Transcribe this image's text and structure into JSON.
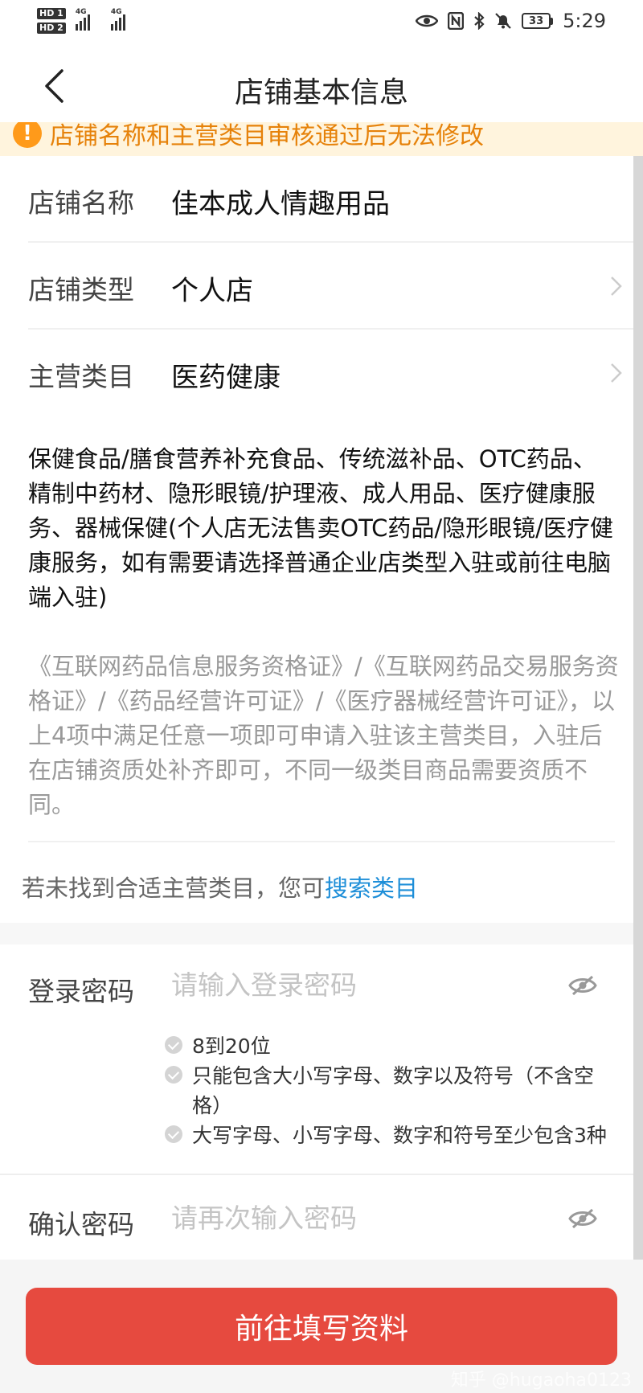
{
  "status_bar": {
    "sim1": "HD 1",
    "sim2": "HD 2",
    "net1": "4G",
    "net2": "4G",
    "battery": "33",
    "time": "5:29"
  },
  "nav": {
    "title": "店铺基本信息",
    "back_icon": "chevron-left-icon"
  },
  "warning": {
    "text": "店铺名称和主营类目审核通过后无法修改",
    "icon": "!"
  },
  "store_info": {
    "name_label": "店铺名称",
    "name_value": "佳本成人情趣用品",
    "type_label": "店铺类型",
    "type_value": "个人店",
    "category_label": "主营类目",
    "category_value": "医药健康",
    "category_desc": "保健食品/膳食营养补充食品、传统滋补品、OTC药品、精制中药材、隐形眼镜/护理液、成人用品、医疗健康服务、器械保健(个人店无法售卖OTC药品/隐形眼镜/医疗健康服务，如有需要请选择普通企业店类型入驻或前往电脑端入驻)",
    "qualification_desc": "《互联网药品信息服务资格证》/《互联网药品交易服务资格证》/《药品经营许可证》/《医疗器械经营许可证》，以上4项中满足任意一项即可申请入驻该主营类目，入驻后在店铺资质处补齐即可，不同一级类目商品需要资质不同。",
    "search_hint_prefix": "若未找到合适主营类目，您可",
    "search_link": "搜索类目"
  },
  "password": {
    "login_label": "登录密码",
    "login_placeholder": "请输入登录密码",
    "login_value": "",
    "rules": [
      "8到20位",
      "只能包含大小写字母、数字以及符号（不含空格）",
      "大写字母、小写字母、数字和符号至少包含3种"
    ],
    "confirm_label": "确认密码",
    "confirm_placeholder": "请再次输入密码",
    "confirm_value": ""
  },
  "footer": {
    "button_label": "前往填写资料"
  },
  "watermark": "知乎 @hugaoha0123",
  "colors": {
    "accent_red": "#e64a3f",
    "link_blue": "#1d8ed8",
    "warning_orange": "#ff9a1a",
    "warning_bg": "#fff4dd"
  }
}
